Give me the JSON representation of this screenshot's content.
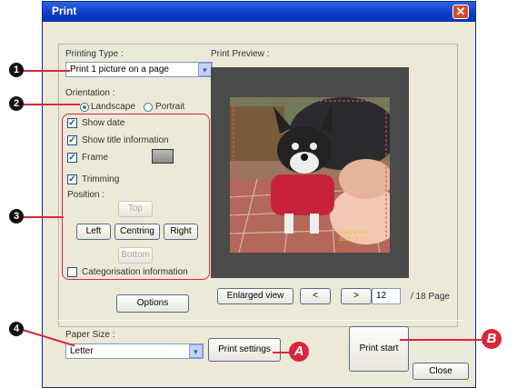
{
  "window": {
    "title": "Print"
  },
  "printing_type": {
    "label": "Printing Type :",
    "value": "Print 1 picture on a page"
  },
  "orientation": {
    "label": "Orientation :",
    "landscape": "Landscape",
    "portrait": "Portrait",
    "selected": "Landscape"
  },
  "options_checks": {
    "show_date": "Show date",
    "show_title": "Show title information",
    "frame": "Frame",
    "trimming": "Trimming",
    "categorisation": "Categorisation information"
  },
  "position": {
    "label": "Position :",
    "top": "Top",
    "left": "Left",
    "centring": "Centring",
    "right": "Right",
    "bottom": "Bottom"
  },
  "options_button": "Options",
  "preview": {
    "label": "Print Preview :",
    "enlarged_view": "Enlarged view",
    "prev": "<",
    "next": ">",
    "page_value": "12",
    "page_total": "/ 18 Page",
    "photo_caption_1": "Sample text",
    "photo_caption_2": "2021 / 8 / 7"
  },
  "paper_size": {
    "label": "Paper Size :",
    "value": "Letter"
  },
  "buttons": {
    "print_settings": "Print settings",
    "print_start": "Print start",
    "close": "Close"
  },
  "callouts": {
    "one": "1",
    "two": "2",
    "three": "3",
    "four": "4",
    "a": "A",
    "b": "B"
  },
  "colors": {
    "title_bar": "#0a3cc6",
    "dialog_bg": "#ece9d8",
    "callout_red": "#d9263a",
    "preview_bg": "#4a4a4a"
  }
}
